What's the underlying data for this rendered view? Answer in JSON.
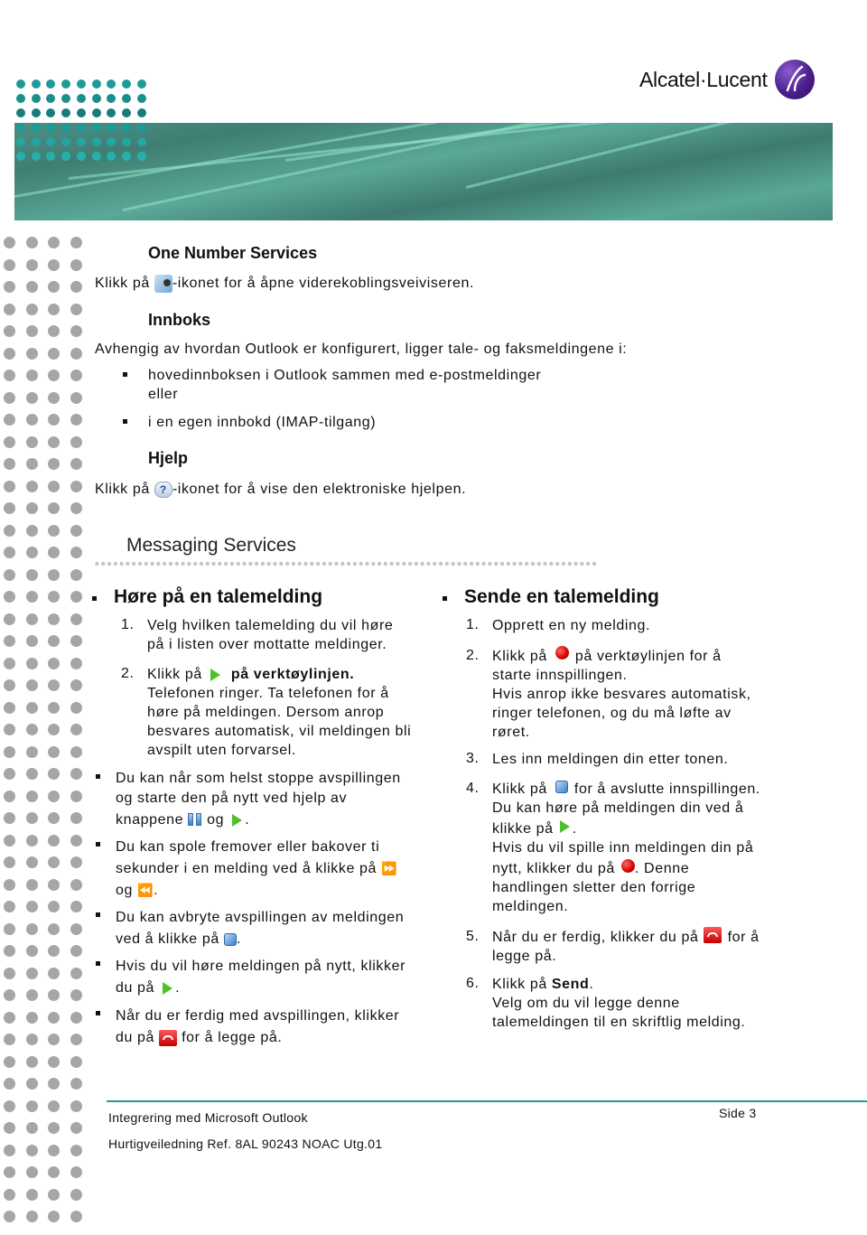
{
  "header": {
    "brand": "Alcatel·Lucent",
    "logo_icon": "alcatel-lucent-a-logo",
    "accent_color": "#2a9a96",
    "banner_color": "#4e8f84"
  },
  "one_number": {
    "heading": "One Number Services",
    "text_before": "Klikk på ",
    "icon": "call-forwarding-wizard-icon",
    "text_after": "-ikonet for å åpne viderekoblingsveiviseren."
  },
  "inbox": {
    "heading": "Innboks",
    "intro": "Avhengig av hvordan Outlook er konfigurert, ligger tale- og faksmeldingene i:",
    "bullets": [
      {
        "line1": "hovedinnboksen i Outlook sammen med e-postmeldinger",
        "line2": "eller"
      },
      {
        "line1": "i en egen innbokd (IMAP-tilgang)"
      }
    ]
  },
  "help": {
    "heading": "Hjelp",
    "text_before": "Klikk på ",
    "icon": "help-icon",
    "text_after": "-ikonet for å vise den elektroniske hjelpen."
  },
  "messaging": {
    "title": "Messaging Services",
    "listen": {
      "heading": "Høre på en talemelding",
      "steps": [
        {
          "num": "1.",
          "lines": [
            "Velg hvilken talemelding du vil høre",
            "på i listen over mottatte meldinger."
          ]
        },
        {
          "num": "2.",
          "prefix": "Klikk på ",
          "bold": "på verktøylinjen.",
          "lines": [
            "Telefonen ringer. Ta telefonen for å",
            "høre på meldingen. Dersom anrop",
            "besvares automatisk, vil meldingen bli",
            "avspilt uten forvarsel."
          ]
        }
      ],
      "bullets": [
        {
          "lines": [
            "Du kan når som helst stoppe avspillingen",
            "og starte den på nytt ved hjelp av"
          ],
          "last_prefix": "knappene ",
          "last_mid": " og ",
          "last_suffix": "."
        },
        {
          "lines": [
            "Du kan spole fremover eller bakover ti"
          ],
          "mid_line": "sekunder i en melding ved å klikke på ",
          "last_prefix": "og ",
          "last_suffix": "."
        },
        {
          "lines": [
            "Du kan avbryte avspillingen av meldingen"
          ],
          "last_prefix": "ved å klikke på ",
          "last_suffix": "."
        },
        {
          "lines": [
            "Hvis du vil høre meldingen på nytt, klikker"
          ],
          "last_prefix": "du på ",
          "last_suffix": "."
        },
        {
          "lines": [
            "Når du er ferdig med avspillingen, klikker"
          ],
          "last_prefix": "du på ",
          "last_suffix": " for å legge på."
        }
      ]
    },
    "send": {
      "heading": "Sende en talemelding",
      "steps": [
        {
          "num": "1.",
          "text": "Opprett en ny melding."
        },
        {
          "num": "2.",
          "prefix": "Klikk på ",
          "suffix": " på verktøylinjen for å",
          "lines": [
            "starte innspillingen.",
            "Hvis anrop ikke besvares automatisk,",
            "ringer telefonen, og du må løfte av",
            "røret."
          ]
        },
        {
          "num": "3.",
          "text": "Les inn meldingen din etter tonen."
        },
        {
          "num": "4.",
          "prefix": "Klikk på ",
          "suffix": " for å avslutte innspillingen.",
          "line2": " Du kan høre på meldingen din ved å",
          "line3_prefix": "klikke på ",
          "line3_suffix": ".",
          "line4": "Hvis du vil spille inn meldingen din på",
          "line5_prefix": "nytt, klikker du på ",
          "line5_suffix": ". Denne",
          "lines": [
            "handlingen sletter den forrige",
            "meldingen."
          ]
        },
        {
          "num": "5.",
          "prefix": "Når du er ferdig, klikker du på ",
          "suffix": " for å",
          "lines": [
            "legge på."
          ]
        },
        {
          "num": "6.",
          "prefix": "Klikk på ",
          "bold": "Send",
          "suffix": ".",
          "lines": [
            "Velg om du vil legge denne",
            "talemeldingen til en skriftlig melding."
          ]
        }
      ]
    }
  },
  "icons": {
    "play": "play-icon",
    "pause": "pause-icon",
    "fast_forward": "fast-forward-icon",
    "rewind": "rewind-icon",
    "stop": "stop-icon",
    "record": "record-icon",
    "hang_up": "hang-up-icon"
  },
  "footer": {
    "title": "Integrering med Microsoft Outlook",
    "reference": "Hurtigveiledning Ref. 8AL 90243 NOAC Utg.01",
    "page": "Side 3"
  }
}
